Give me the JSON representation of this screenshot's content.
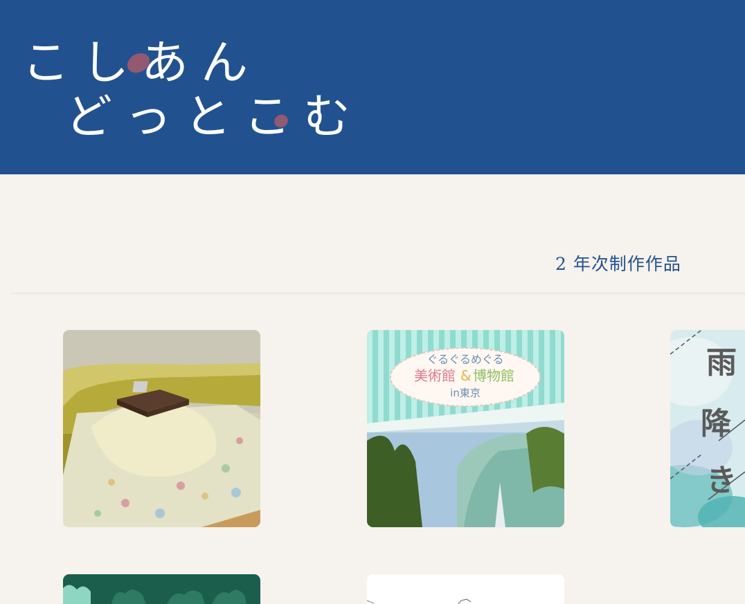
{
  "header": {
    "logo_line1": "こしあん",
    "logo_line2": "どっとこむ",
    "background_color": "#21528f",
    "accent_color": "#a05a6e"
  },
  "section": {
    "title": "2 年次制作作品"
  },
  "works": [
    {
      "name": "kotatsu-3d",
      "icon": "kotatsu-room-image"
    },
    {
      "name": "museum-tokyo",
      "icon": "museum-building-image",
      "banner_line1": "ぐるぐるめぐる",
      "banner_line2_a": "美術館",
      "banner_line2_amp": "&",
      "banner_line2_b": "博物館",
      "banner_line3": "in東京"
    },
    {
      "name": "rain-poem",
      "icon": "rain-text-image",
      "chars": [
        "雨",
        "降",
        "き"
      ]
    },
    {
      "name": "forest-green",
      "icon": "forest-image"
    },
    {
      "name": "sketch-white",
      "icon": "sketch-image"
    }
  ]
}
